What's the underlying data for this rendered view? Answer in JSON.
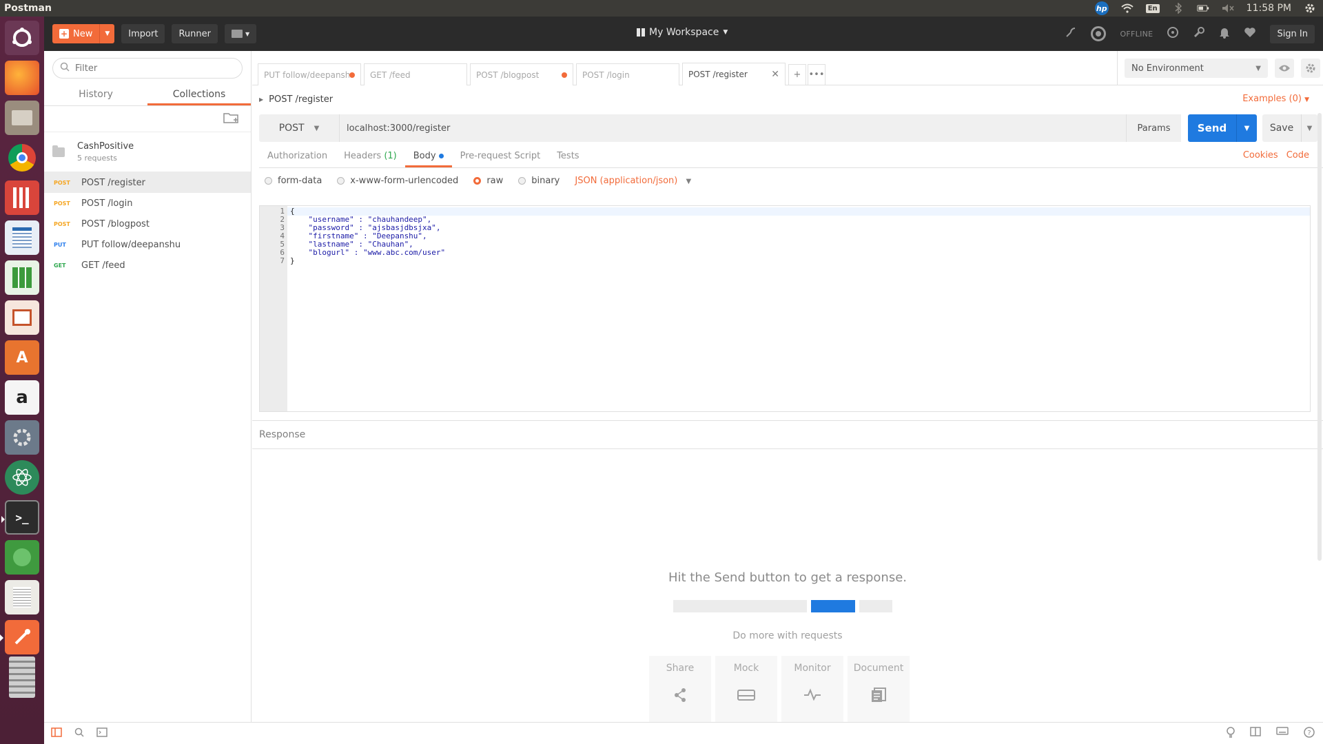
{
  "os": {
    "app_name": "Postman",
    "indicators": {
      "hp": "hp",
      "lang": "En"
    },
    "clock": "11:58 PM",
    "launcher": [
      "ubuntu-icon",
      "firefox-icon",
      "files-icon",
      "chrome-icon",
      "popcorn-icon",
      "writer-icon",
      "calc-icon",
      "impress-icon",
      "software-center-icon",
      "amazon-icon",
      "settings-icon",
      "atom-icon",
      "terminal-icon",
      "ros-icon",
      "text-editor-icon",
      "postman-icon",
      "trash-icon"
    ]
  },
  "header": {
    "new_label": "New",
    "import_label": "Import",
    "runner_label": "Runner",
    "workspace_label": "My Workspace",
    "offline_label": "OFFLINE",
    "signin_label": "Sign In"
  },
  "sidebar": {
    "filter_placeholder": "Filter",
    "tabs": [
      "History",
      "Collections"
    ],
    "active_tab": "Collections",
    "collection": {
      "name": "CashPositive",
      "count": "5 requests"
    },
    "requests": [
      {
        "method": "POST",
        "name": "POST /register",
        "active": true
      },
      {
        "method": "POST",
        "name": "POST /login"
      },
      {
        "method": "POST",
        "name": "POST /blogpost"
      },
      {
        "method": "PUT",
        "name": "PUT follow/deepanshu"
      },
      {
        "method": "GET",
        "name": "GET /feed"
      }
    ]
  },
  "tabs": [
    {
      "label": "PUT follow/deepansh",
      "dirty": true
    },
    {
      "label": "GET /feed",
      "dirty": false
    },
    {
      "label": "POST /blogpost",
      "dirty": true
    },
    {
      "label": "POST /login",
      "dirty": false
    },
    {
      "label": "POST /register",
      "active": true
    }
  ],
  "environment": {
    "selected": "No Environment"
  },
  "request": {
    "title": "POST /register",
    "examples_label": "Examples (0)",
    "method": "POST",
    "url": "localhost:3000/register",
    "params_label": "Params",
    "send_label": "Send",
    "save_label": "Save"
  },
  "subtabs": {
    "authorization": "Authorization",
    "headers": "Headers",
    "headers_count": "(1)",
    "body": "Body",
    "prerequest": "Pre-request Script",
    "tests": "Tests",
    "cookies": "Cookies",
    "code": "Code"
  },
  "body_options": {
    "form_data": "form-data",
    "urlencoded": "x-www-form-urlencoded",
    "raw": "raw",
    "binary": "binary",
    "content_type": "JSON (application/json)",
    "selected": "raw"
  },
  "editor": {
    "line_numbers": [
      "1",
      "2",
      "3",
      "4",
      "5",
      "6",
      "7"
    ],
    "lines": [
      "{",
      "    \"username\" : \"chauhandeep\",",
      "    \"password\" : \"ajsbasjdbsjxa\",",
      "    \"firstname\" : \"Deepanshu\",",
      "    \"lastname\" : \"Chauhan\",",
      "    \"blogurl\" : \"www.abc.com/user\"",
      "}"
    ]
  },
  "response": {
    "header": "Response",
    "hint": "Hit the Send button to get a response.",
    "do_more": "Do more with requests",
    "cards": [
      "Share",
      "Mock",
      "Monitor",
      "Document"
    ]
  },
  "colors": {
    "accent": "#f26b3a",
    "send": "#1f7ae0",
    "post": "#f5a623",
    "put": "#2f80ed",
    "get": "#2fa84f"
  }
}
